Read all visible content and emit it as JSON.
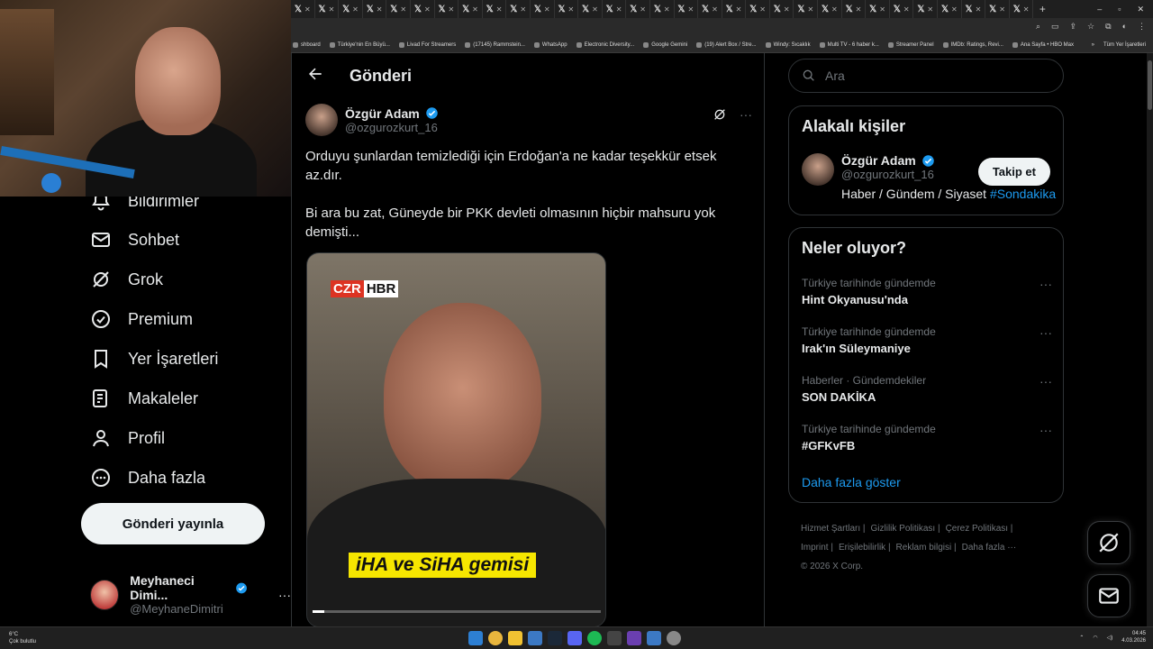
{
  "browser": {
    "tab_count": 31,
    "tab_icon": "x-logo",
    "tab_icon_glyph": "𝕏",
    "new_tab_glyph": "+",
    "window_controls": [
      "–",
      "▫",
      "✕"
    ],
    "bookmarks": [
      "shboard",
      "Türkiye'nin En Büyü...",
      "Livad For Streamers",
      "(17145) Rammstein...",
      "WhatsApp",
      "Electronic Diversity...",
      "Google Gemini",
      "(19) Alert Box / Stre...",
      "Windy: Sıcaklık",
      "Multi TV - 6 haber k...",
      "Streamer Panel",
      "IMDb: Ratings, Revi...",
      "Ana Sayfa • HBO Max"
    ],
    "bookmarks_overflow": "»",
    "all_bookmarks": "Tüm Yer İşaretleri"
  },
  "nav": {
    "items": [
      {
        "label": "Bildirimler",
        "icon": "bell-icon"
      },
      {
        "label": "Sohbet",
        "icon": "mail-icon"
      },
      {
        "label": "Grok",
        "icon": "grok-icon"
      },
      {
        "label": "Premium",
        "icon": "verified-icon"
      },
      {
        "label": "Yer İşaretleri",
        "icon": "bookmark-icon"
      },
      {
        "label": "Makaleler",
        "icon": "article-icon"
      },
      {
        "label": "Profil",
        "icon": "profile-icon"
      },
      {
        "label": "Daha fazla",
        "icon": "more-circle-icon"
      }
    ],
    "post_button": "Gönderi yayınla",
    "account": {
      "name": "Meyhaneci Dimi...",
      "handle": "@MeyhaneDimitri",
      "more": "···"
    }
  },
  "main": {
    "title": "Gönderi",
    "post": {
      "author": "Özgür Adam",
      "handle": "@ozgurozkurt_16",
      "more": "···",
      "paragraphs": [
        "Orduyu şunlardan temizlediği için Erdoğan'a ne kadar teşekkür etsek az.dır.",
        "Bi ara bu zat, Güneyde bir PKK devleti olmasının hiçbir mahsuru yok demişti..."
      ],
      "media": {
        "logo_left": "CZR",
        "logo_right": "HBR",
        "caption": "iHA ve SiHA gemisi",
        "progress": 0.04
      }
    }
  },
  "sidebar": {
    "search_placeholder": "Ara",
    "related": {
      "title": "Alakalı kişiler",
      "name": "Özgür Adam",
      "handle": "@ozgurozkurt_16",
      "bio": "Haber / Gündem / Siyaset ",
      "bio_tag": "#Sondakika",
      "follow": "Takip et"
    },
    "trends": {
      "title": "Neler oluyor?",
      "items": [
        {
          "context": "Türkiye tarihinde gündemde",
          "name": "Hint Okyanusu'nda"
        },
        {
          "context": "Türkiye tarihinde gündemde",
          "name": "Irak'ın Süleymaniye"
        },
        {
          "context": "Haberler · Gündemdekiler",
          "name": "SON DAKİKA"
        },
        {
          "context": "Türkiye tarihinde gündemde",
          "name": "#GFKvFB"
        }
      ],
      "item_more": "···",
      "show_more": "Daha fazla göster"
    },
    "footer": {
      "links_row1": [
        "Hizmet Şartları |",
        "Gizlilik Politikası |",
        "Çerez Politikası |"
      ],
      "links_row2": [
        "Imprint |",
        "Erişilebilirlik |",
        "Reklam bilgisi |",
        "Daha fazla ···"
      ],
      "copyright": "© 2026 X Corp."
    }
  },
  "taskbar": {
    "temperature": "6°C",
    "weather": "Çok bulutlu",
    "time": "04:45",
    "date": "4.03.2026"
  },
  "colors": {
    "accent": "#1d9bf0",
    "background": "#000000",
    "border": "#2f3336",
    "muted": "#71767b",
    "caption_yellow": "#f6e600"
  }
}
